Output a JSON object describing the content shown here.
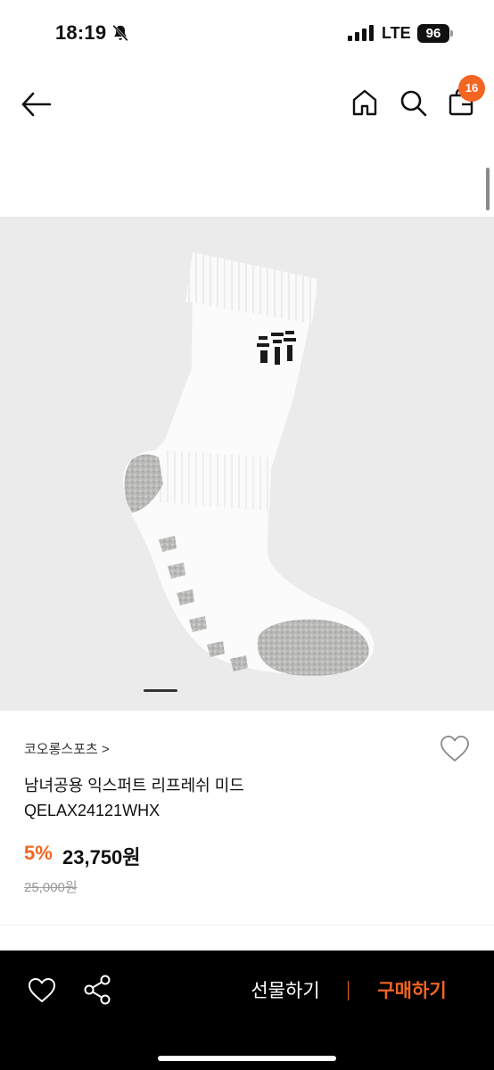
{
  "status_bar": {
    "time": "18:19",
    "network": "LTE",
    "battery": "96",
    "icons": [
      "bell-off-icon",
      "signal-icon",
      "battery-icon"
    ]
  },
  "nav": {
    "icons": [
      "back-arrow-icon",
      "home-icon",
      "search-icon",
      "shopping-bag-icon"
    ],
    "cart_count": "16"
  },
  "product": {
    "image_icon": "sock-product-image",
    "carousel_position": 1,
    "brand": "코오롱스포츠 >",
    "name_line1": "남녀공용 익스퍼트 리프레쉬 미드",
    "name_line2": "QELAX24121WHX",
    "discount": "5%",
    "price": "23,750원",
    "original_price": "25,000원"
  },
  "bottom_bar": {
    "icons": [
      "heart-outline-icon",
      "share-icon"
    ],
    "gift_label": "선물하기",
    "buy_label": "구매하기"
  },
  "colors": {
    "accent": "#f26522",
    "bottom_bar_bg": "#000000",
    "image_bg": "#ebebeb"
  }
}
